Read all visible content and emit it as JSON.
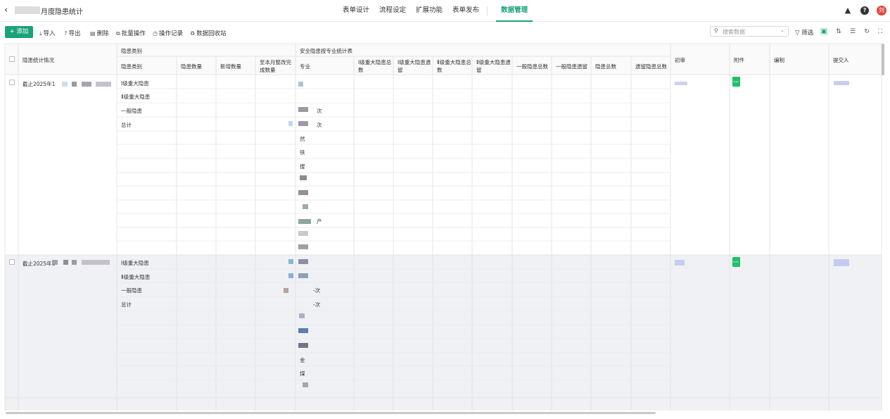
{
  "header": {
    "back_icon": "chevron-left-icon",
    "title": "月度隐患统计",
    "tabs": [
      {
        "label": "表单设计"
      },
      {
        "label": "流程设定"
      },
      {
        "label": "扩展功能"
      },
      {
        "label": "表单发布"
      },
      {
        "label": "数据管理",
        "active": true
      }
    ],
    "help": "?",
    "avatar": "刘"
  },
  "toolbar": {
    "add": "+ 添加",
    "import": "导入",
    "export": "导出",
    "delete": "删除",
    "batch": "批量操作",
    "log": "操作记录",
    "recycle": "数据回收站",
    "search_placeholder": "搜索数据",
    "filter": "筛选"
  },
  "table": {
    "col_situation": "隐患统计情况",
    "group_category": "隐患类别",
    "cols_category": [
      "隐患类别",
      "隐患数量",
      "新增数量",
      "至本月整改完成数量"
    ],
    "group_specialty": "安全隐患按专业统计表",
    "cols_specialty": [
      "专业",
      "Ⅰ级重大隐患总数",
      "Ⅰ级重大隐患遗留",
      "Ⅱ级重大隐患总数",
      "Ⅱ级重大隐患遗留",
      "一般隐患总数",
      "一般隐患遗留",
      "隐患总数",
      "遗留隐患总数"
    ],
    "col_review": "初审",
    "col_attachment": "附件",
    "col_author": "编制",
    "col_submitter": "提交人",
    "rows": [
      {
        "situation": "截止2025年1",
        "categories": [
          "Ⅰ级重大隐患",
          "Ⅱ级重大隐患",
          "一般隐患",
          "总计"
        ],
        "specialty_text": [
          "次",
          "次",
          "然",
          "铁",
          "搜",
          "产"
        ],
        "attachment": "XLSX"
      },
      {
        "situation": "截止2025年1",
        "categories": [
          "Ⅰ级重大隐患",
          "Ⅱ级重大隐患",
          "一般隐患",
          "总计"
        ],
        "specialty_text": [
          "-次",
          "-次",
          "金",
          "煤"
        ],
        "attachment": "XLSX"
      }
    ]
  }
}
